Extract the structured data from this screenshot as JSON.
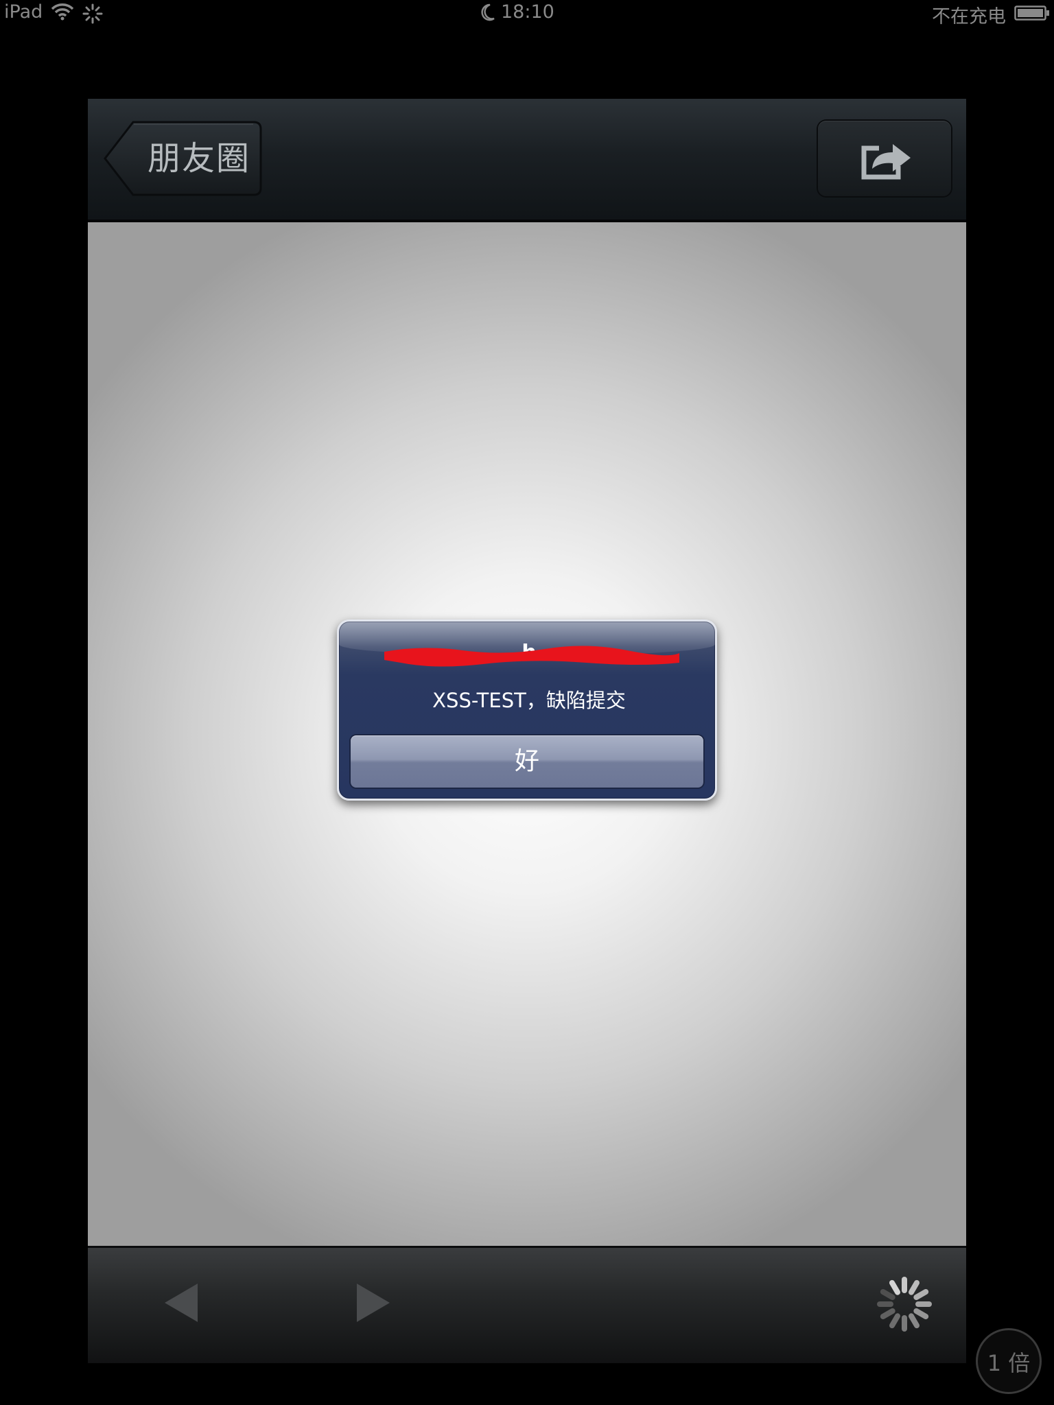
{
  "status_bar": {
    "carrier": "iPad",
    "time": "18:10",
    "charging_status": "不在充电"
  },
  "nav_bar": {
    "back_label": "朋友圈",
    "share_icon": "share-icon"
  },
  "alert": {
    "title": "h",
    "message": "XSS-TEST，缺陷提交",
    "ok_label": "好",
    "redaction_color": "#e8141c"
  },
  "toolbar": {
    "back_icon": "back-arrow-icon",
    "forward_icon": "forward-arrow-icon",
    "spinner_icon": "loading-spinner-icon"
  },
  "zoom_badge": {
    "label": "1 倍"
  },
  "colors": {
    "alert_body": "#273660",
    "alert_button": "#8e97b1",
    "nav_bar": "#1a1f23",
    "content_center": "#ffffff",
    "content_edge": "#9e9e9e"
  }
}
